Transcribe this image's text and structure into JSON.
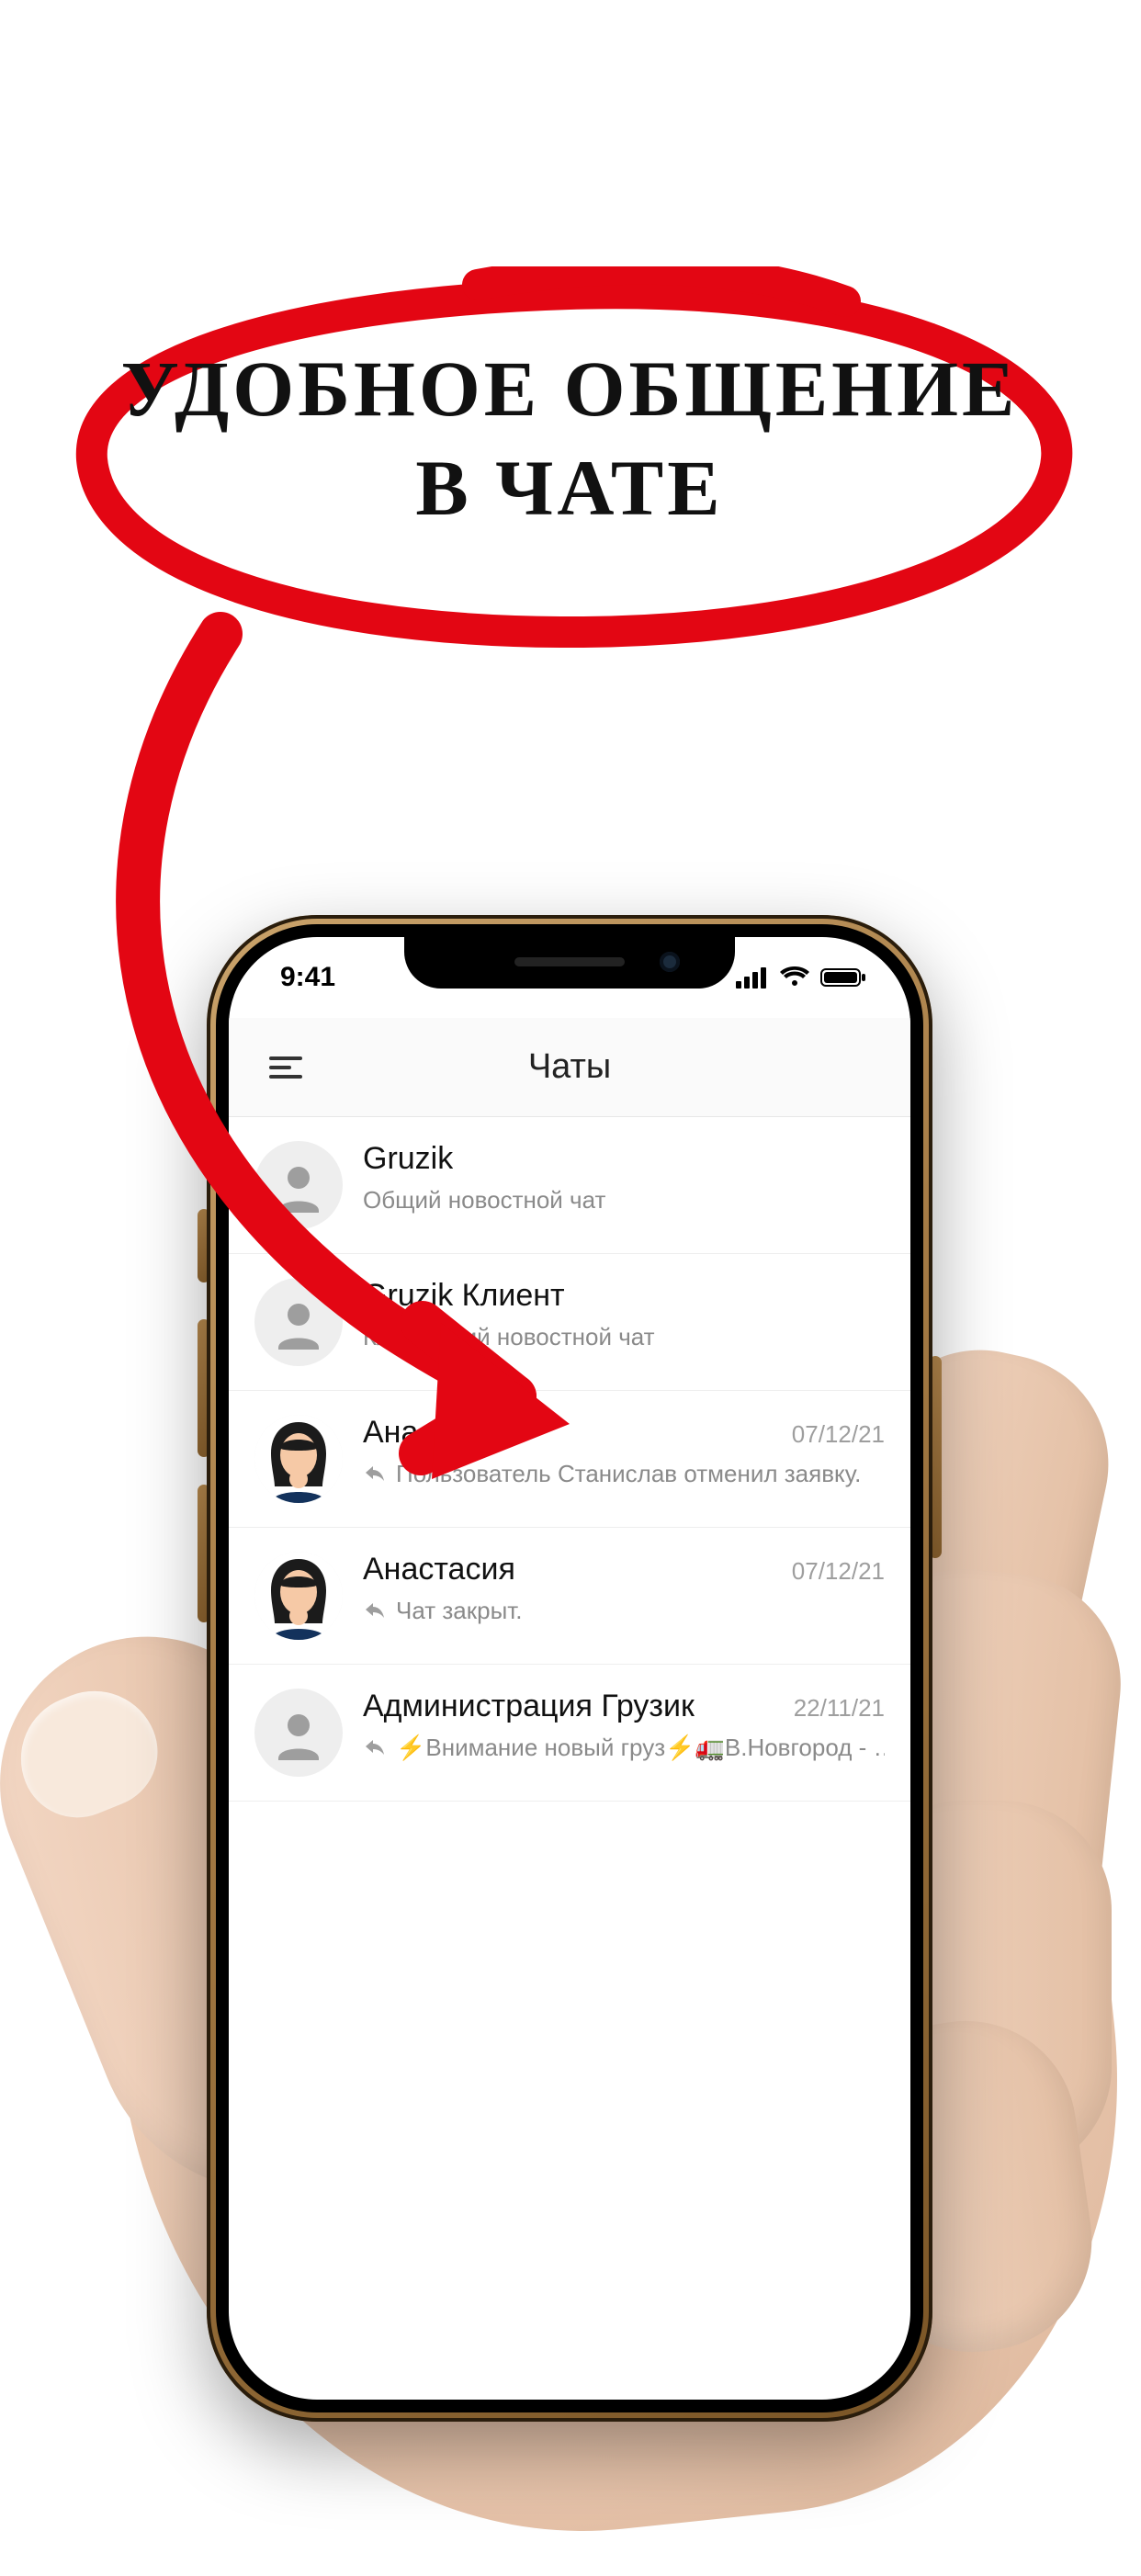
{
  "callout": {
    "line1": "УДОБНОЕ ОБЩЕНИЕ",
    "line2": "В ЧАТЕ"
  },
  "status_bar": {
    "time": "9:41"
  },
  "app": {
    "header_title": "Чаты"
  },
  "chats": [
    {
      "avatar_type": "generic",
      "name": "Gruzik",
      "date": "",
      "has_reply_icon": false,
      "subtitle": "Общий новостной чат"
    },
    {
      "avatar_type": "generic",
      "name": "Gruzik Клиент",
      "date": "",
      "has_reply_icon": false,
      "subtitle": "Клиентский новостной чат"
    },
    {
      "avatar_type": "female",
      "name": "Анастасия",
      "date": "07/12/21",
      "has_reply_icon": true,
      "subtitle": "Пользователь Станислав отменил заявку."
    },
    {
      "avatar_type": "female",
      "name": "Анастасия",
      "date": "07/12/21",
      "has_reply_icon": true,
      "subtitle": "Чат закрыт."
    },
    {
      "avatar_type": "generic",
      "name": "Администрация Грузик",
      "date": "22/11/21",
      "has_reply_icon": true,
      "subtitle": "⚡Внимание новый груз⚡🚛В.Новгород - …"
    }
  ]
}
